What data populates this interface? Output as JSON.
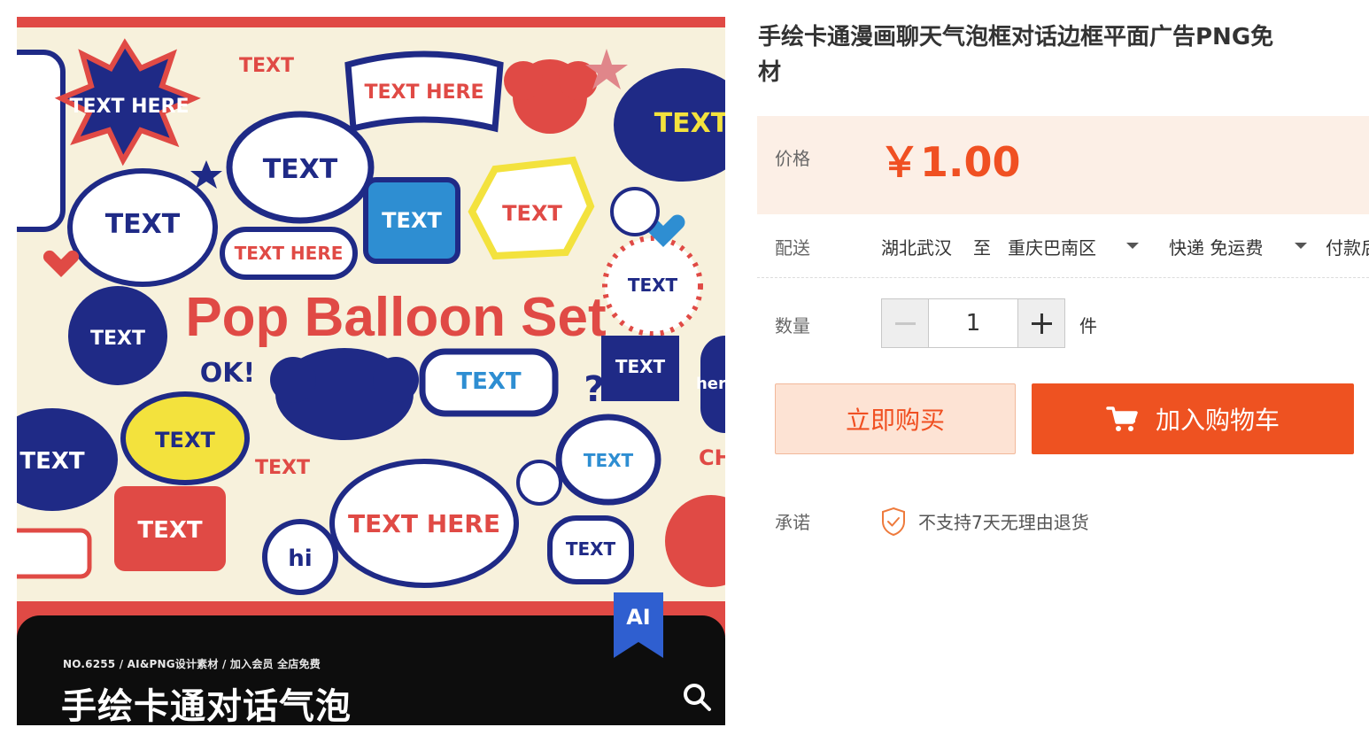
{
  "product": {
    "title_line1": "手绘卡通漫画聊天气泡框对话边框平面广告PNG免",
    "title_line2": "材",
    "image": {
      "banner_text": "Pop Balloon Set",
      "bubble_texts": [
        "TEXT HERE",
        "TEXT",
        "TEXT HERE",
        "TEXT",
        "TEXT HERE",
        "OK!",
        "hi",
        "CHECK",
        "here"
      ],
      "meta_line": "NO.6255 / AI&PNG设计素材 / 加入会员 全店免费",
      "overlay_title": "手绘卡通对话气泡",
      "ai_badge": "AI"
    }
  },
  "price": {
    "label": "价格",
    "value": "￥1.00"
  },
  "shipping": {
    "label": "配送",
    "from": "湖北武汉",
    "to_word": "至",
    "destination": "重庆巴南区",
    "method": "快递 免运费",
    "extra": "付款后"
  },
  "quantity": {
    "label": "数量",
    "value": "1",
    "unit": "件"
  },
  "actions": {
    "buy_now": "立即购买",
    "add_to_cart": "加入购物车"
  },
  "promise": {
    "label": "承诺",
    "text": "不支持7天无理由退货"
  },
  "colors": {
    "accent": "#ee5221",
    "price": "#f05022",
    "price_bg": "#fcefe6",
    "navy": "#1f2a86",
    "red": "#e04a45"
  }
}
